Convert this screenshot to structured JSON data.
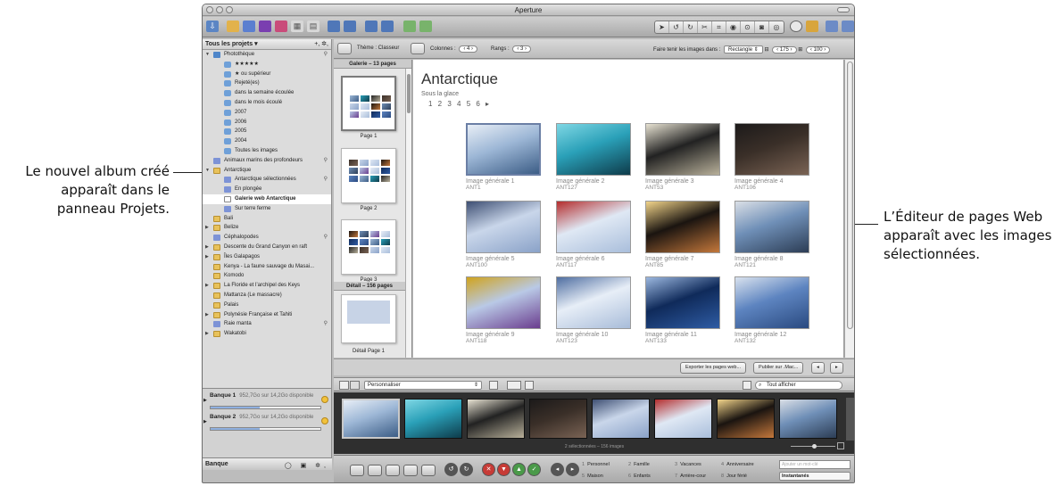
{
  "callouts": {
    "left_text": "Le nouvel album créé apparaît dans le panneau Projets.",
    "right_text": "L’Éditeur de pages Web apparaît avec les images sélectionnées."
  },
  "window": {
    "title": "Aperture"
  },
  "projects": {
    "header": "Tous les projets ▾",
    "header_buttons": "+, ✲,",
    "items": [
      {
        "label": "Photothèque",
        "icon": "library-icon",
        "indent": 0,
        "triangle": "open",
        "gear": true
      },
      {
        "label": "★★★★★",
        "icon": "smart-album-icon",
        "indent": 1
      },
      {
        "label": "★ ou supérieur",
        "icon": "smart-album-icon",
        "indent": 1
      },
      {
        "label": "Rejeté(es)",
        "icon": "smart-album-icon",
        "indent": 1
      },
      {
        "label": "dans la semaine écoulée",
        "icon": "smart-album-icon",
        "indent": 1
      },
      {
        "label": "dans le mois écoulé",
        "icon": "smart-album-icon",
        "indent": 1
      },
      {
        "label": "2007",
        "icon": "smart-album-icon",
        "indent": 1
      },
      {
        "label": "2006",
        "icon": "smart-album-icon",
        "indent": 1
      },
      {
        "label": "2005",
        "icon": "smart-album-icon",
        "indent": 1
      },
      {
        "label": "2004",
        "icon": "smart-album-icon",
        "indent": 1
      },
      {
        "label": "Toutes les images",
        "icon": "smart-album-icon",
        "indent": 1
      },
      {
        "label": "Animaux marins des profondeurs",
        "icon": "album-icon",
        "indent": 0,
        "gear": true
      },
      {
        "label": "Antarctique",
        "icon": "folder-icon",
        "indent": 0,
        "triangle": "open"
      },
      {
        "label": "Antarctique sélectionnées",
        "icon": "album-icon",
        "indent": 1,
        "gear": true
      },
      {
        "label": "En plongée",
        "icon": "album-icon",
        "indent": 1
      },
      {
        "label": "Galerie web Antarctique",
        "icon": "web-gallery-icon",
        "indent": 1,
        "selected": true
      },
      {
        "label": "Sur terre ferme",
        "icon": "album-icon",
        "indent": 1
      },
      {
        "label": "Bali",
        "icon": "folder-icon",
        "indent": 0
      },
      {
        "label": "Belize",
        "icon": "folder-icon",
        "indent": 0,
        "triangle": "closed"
      },
      {
        "label": "Céphalopodes",
        "icon": "album-icon",
        "indent": 0,
        "gear": true
      },
      {
        "label": "Descente du Grand Canyon en raft",
        "icon": "folder-icon",
        "indent": 0,
        "triangle": "closed"
      },
      {
        "label": "Îles Galapagos",
        "icon": "folder-icon",
        "indent": 0,
        "triangle": "closed"
      },
      {
        "label": "Kenya - La faune sauvage du Masai...",
        "icon": "folder-icon",
        "indent": 0
      },
      {
        "label": "Komodo",
        "icon": "folder-icon",
        "indent": 0
      },
      {
        "label": "La Floride et l’archipel des Keys",
        "icon": "folder-icon",
        "indent": 0,
        "triangle": "closed"
      },
      {
        "label": "Mattanza (Le massacre)",
        "icon": "folder-icon",
        "indent": 0
      },
      {
        "label": "Palais",
        "icon": "folder-icon",
        "indent": 0
      },
      {
        "label": "Polynésie Française et Tahiti",
        "icon": "folder-icon",
        "indent": 0,
        "triangle": "closed"
      },
      {
        "label": "Raie manta",
        "icon": "album-icon",
        "indent": 0,
        "gear": true
      },
      {
        "label": "Wakatobi",
        "icon": "folder-icon",
        "indent": 0,
        "triangle": "closed"
      }
    ]
  },
  "vaults": {
    "items": [
      {
        "name": "Banque 1",
        "capacity": "952,7Go sur 14,2Go disponible",
        "fill_fraction": 0.45
      },
      {
        "name": "Banque 2",
        "capacity": "952,7Go sur 14,2Go disponible",
        "fill_fraction": 0.45
      }
    ],
    "footer": "Banque",
    "footer_buttons": "◯ ▣ ✲,"
  },
  "editor_bar": {
    "theme": "Thème : Classeur",
    "columns_label": "Colonnes :",
    "columns_value": "4",
    "rows_label": "Rangs :",
    "rows_value": "3",
    "fit_label": "Faire tenir les images dans :",
    "fit_value": "Rectangle",
    "width_value": "175",
    "height_value": "100"
  },
  "pages_panel": {
    "gallery_header": "Galerie – 13 pages",
    "detail_header": "Détail – 156 pages",
    "pages": [
      "Page 1",
      "Page 2",
      "Page 3"
    ],
    "detail_page": "Détail Page 1"
  },
  "gallery": {
    "title": "Antarctique",
    "subtitle": "Sous la glace",
    "pages_nav": "1 2 3 4 5 6 ▸",
    "images": [
      {
        "caption": "Image générale  1",
        "code": "ANT1",
        "colors": [
          "#9db7d6",
          "#3c5d86",
          "#e8eef6"
        ]
      },
      {
        "caption": "Image générale  2",
        "code": "ANT127",
        "colors": [
          "#2aa0b8",
          "#0e3b4a",
          "#7fd7e4"
        ]
      },
      {
        "caption": "Image générale  3",
        "code": "ANT53",
        "colors": [
          "#222222",
          "#b8b09a",
          "#e7e2d2"
        ]
      },
      {
        "caption": "Image générale  4",
        "code": "ANT106",
        "colors": [
          "#3a2f28",
          "#7a6354",
          "#1c1a1a"
        ]
      },
      {
        "caption": "Image générale  5",
        "code": "ANT100",
        "colors": [
          "#c9d6ea",
          "#8aa2c8",
          "#3e4f73"
        ]
      },
      {
        "caption": "Image générale  6",
        "code": "ANT117",
        "colors": [
          "#dfe8f4",
          "#a9bedb",
          "#b42d2d"
        ]
      },
      {
        "caption": "Image générale  7",
        "code": "ANT85",
        "colors": [
          "#1a1410",
          "#c4783b",
          "#f2d48a"
        ]
      },
      {
        "caption": "Image générale  8",
        "code": "ANT121",
        "colors": [
          "#6f8fb7",
          "#2c3d55",
          "#dadfe6"
        ]
      },
      {
        "caption": "Image générale  9",
        "code": "ANT118",
        "colors": [
          "#b9c9e6",
          "#6a3d8e",
          "#d0a31d"
        ]
      },
      {
        "caption": "Image générale  10",
        "code": "ANT123",
        "colors": [
          "#e7eef7",
          "#a8bcd9",
          "#4f6ea1"
        ]
      },
      {
        "caption": "Image générale  11",
        "code": "ANT133",
        "colors": [
          "#0f2a5a",
          "#2f5ca4",
          "#9bb7df"
        ]
      },
      {
        "caption": "Image générale  12",
        "code": "ANT132",
        "colors": [
          "#5d84c0",
          "#2a4a80",
          "#d9e2ee"
        ]
      }
    ]
  },
  "export_bar": {
    "export_label": "Exporter les pages web...",
    "publish_label": "Publier sur .Mac..."
  },
  "browser": {
    "filter": "Personnaliser",
    "search_placeholder": "Tout afficher",
    "status": "2 sélectionnées – 156 images"
  },
  "keywords": {
    "row1": [
      [
        "1",
        "Personnel"
      ],
      [
        "2",
        "Famille"
      ],
      [
        "3",
        "Vacances"
      ],
      [
        "4",
        "Anniversaire"
      ]
    ],
    "row2": [
      [
        "5",
        "Maison"
      ],
      [
        "6",
        "Enfants"
      ],
      [
        "7",
        "Arrière-cour"
      ],
      [
        "8",
        "Jour férié"
      ]
    ],
    "input_placeholder": "Ajouter un mot-clé",
    "set": "Instantanés"
  }
}
